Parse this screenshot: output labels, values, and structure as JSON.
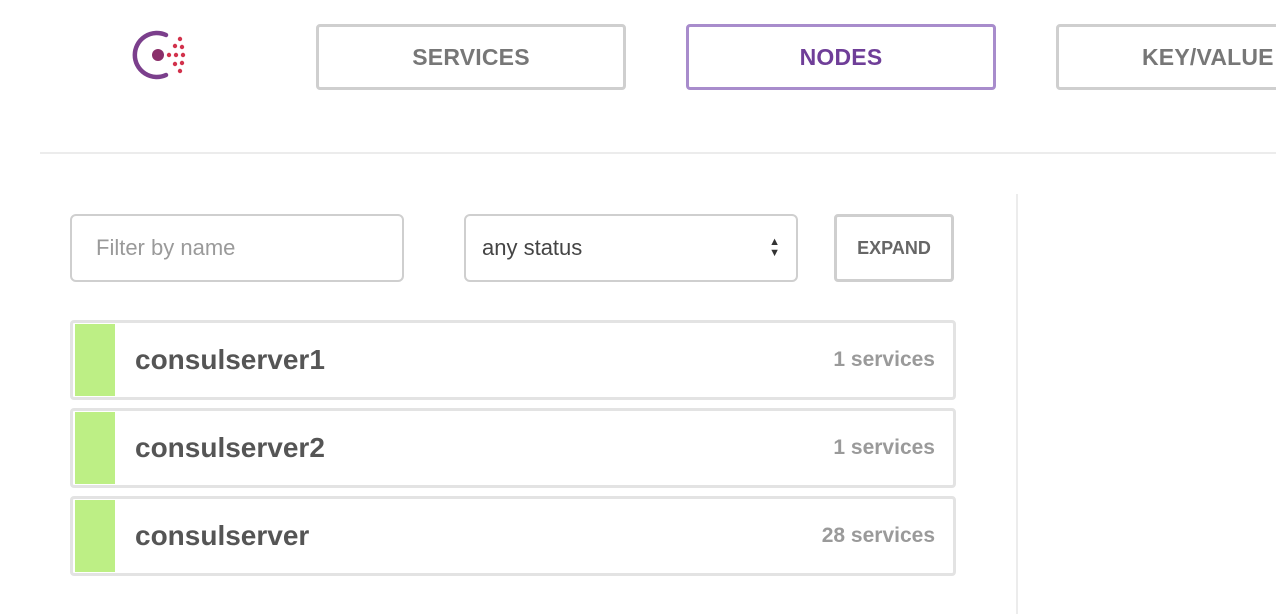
{
  "header": {
    "nav": [
      {
        "label": "SERVICES",
        "active": false
      },
      {
        "label": "NODES",
        "active": true
      },
      {
        "label": "KEY/VALUE",
        "active": false
      }
    ]
  },
  "filters": {
    "name_placeholder": "Filter by name",
    "name_value": "",
    "status_selected": "any status",
    "expand_label": "EXPAND"
  },
  "nodes": [
    {
      "name": "consulserver1",
      "services": "1 services",
      "status": "passing"
    },
    {
      "name": "consulserver2",
      "services": "1 services",
      "status": "passing"
    },
    {
      "name": "consulserver",
      "services": "28 services",
      "status": "passing"
    }
  ],
  "colors": {
    "brand": "#7b3f8c",
    "accent": "#d2324c",
    "active_nav": "#6f3e98",
    "passing": "#bdef85"
  },
  "icons": {
    "logo": "consul-logo-icon",
    "select_arrows": "select-arrows-icon"
  }
}
